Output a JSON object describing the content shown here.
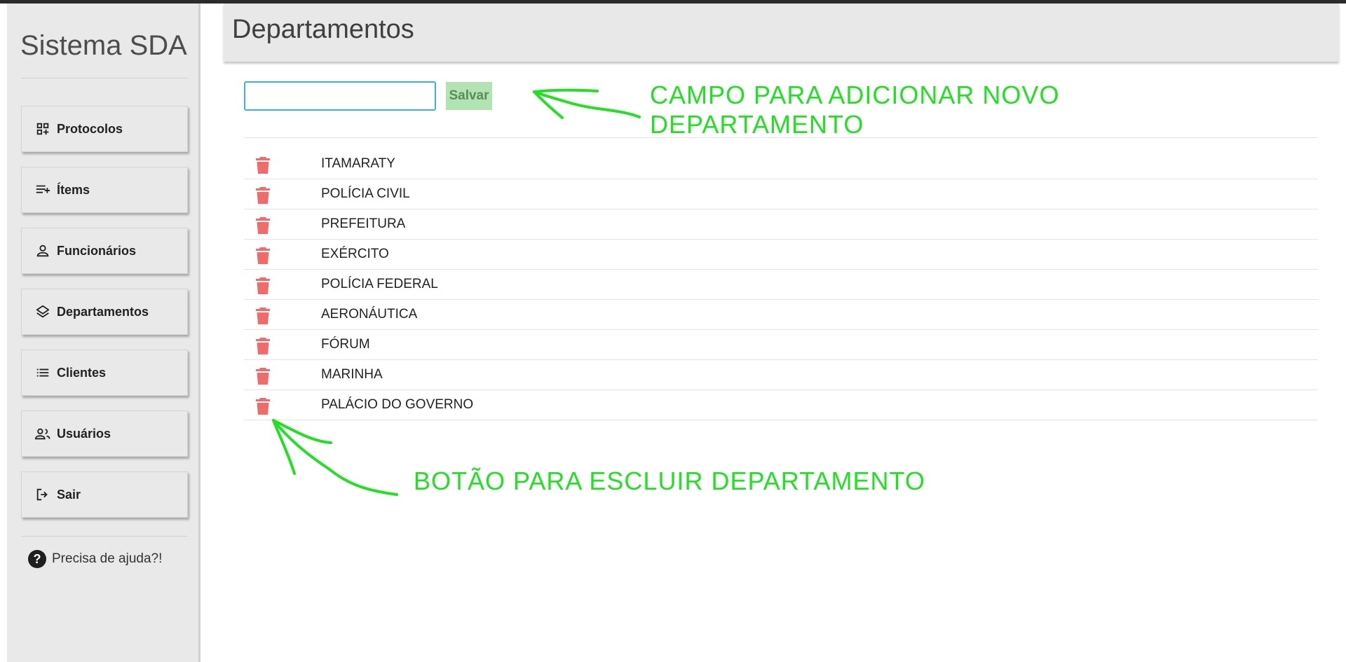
{
  "app": {
    "brand": "Sistema SDA"
  },
  "header": {
    "title": "Departamentos"
  },
  "sidebar": {
    "items": [
      {
        "label": "Protocolos",
        "icon": "grid-plus-icon"
      },
      {
        "label": "Ítems",
        "icon": "playlist-add-icon"
      },
      {
        "label": "Funcionários",
        "icon": "person-icon"
      },
      {
        "label": "Departamentos",
        "icon": "layers-icon"
      },
      {
        "label": "Clientes",
        "icon": "list-icon"
      },
      {
        "label": "Usuários",
        "icon": "people-icon"
      },
      {
        "label": "Sair",
        "icon": "logout-icon"
      }
    ],
    "help_label": "Precisa de ajuda?!"
  },
  "form": {
    "input_value": "",
    "save_label": "Salvar",
    "save_color": "#b2e3b2"
  },
  "departments": [
    "ITAMARATY",
    "POLÍCIA CIVIL",
    "PREFEITURA",
    "EXÉRCITO",
    "POLÍCIA FEDERAL",
    "AERONÁUTICA",
    "FÓRUM",
    "MARINHA",
    "PALÁCIO DO GOVERNO"
  ],
  "colors": {
    "trash": "#f26b6b",
    "annotation": "#22e022",
    "input_border": "#3ab3d6"
  },
  "annotations": {
    "add_field_line1": "CAMPO PARA ADICIONAR NOVO",
    "add_field_line2": "DEPARTAMENTO",
    "delete_button": "BOTÃO PARA ESCLUIR DEPARTAMENTO"
  }
}
